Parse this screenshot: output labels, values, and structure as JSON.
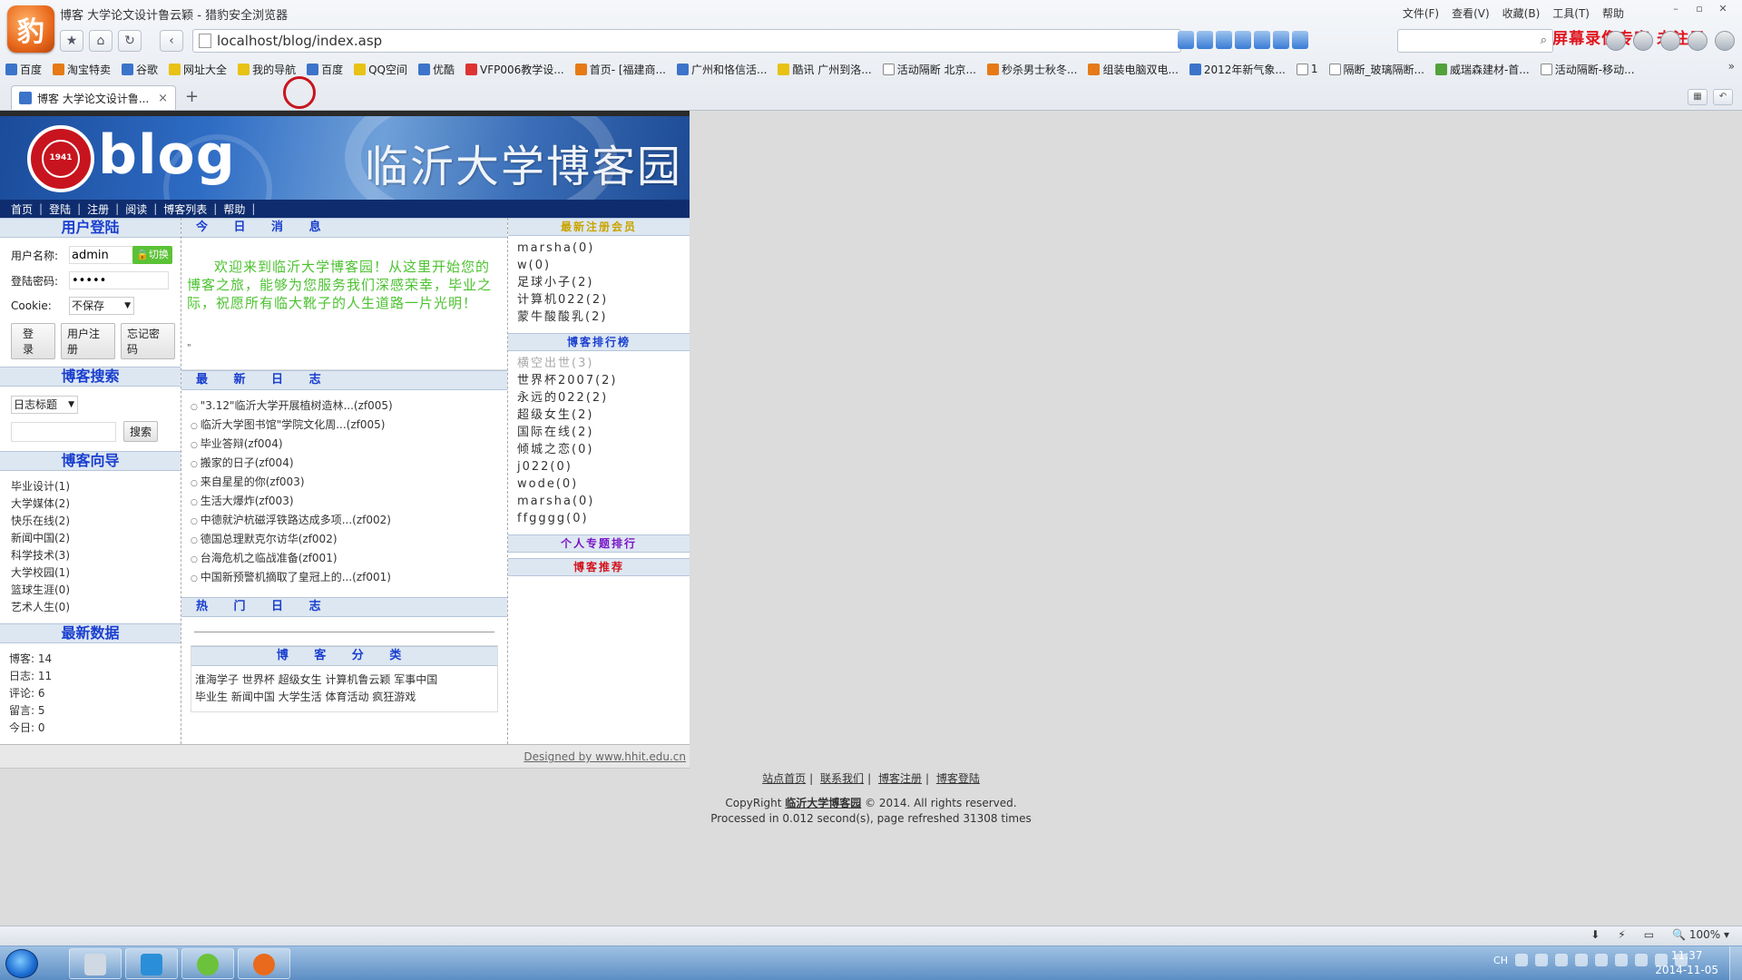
{
  "window": {
    "title": "博客 大学论文设计鲁云颖 - 猎豹安全浏览器",
    "menu": [
      "文件(F)",
      "查看(V)",
      "收藏(B)",
      "工具(T)",
      "帮助"
    ],
    "watermark": "屏幕录像专家 未注册"
  },
  "address": {
    "url": "localhost/blog/index.asp"
  },
  "bookmarks": [
    {
      "label": "百度",
      "color": "b"
    },
    {
      "label": "淘宝特卖",
      "color": "o"
    },
    {
      "label": "谷歌",
      "color": "b"
    },
    {
      "label": "网址大全",
      "color": "y"
    },
    {
      "label": "我的导航",
      "color": "y"
    },
    {
      "label": "百度",
      "color": "b"
    },
    {
      "label": "QQ空间",
      "color": "y"
    },
    {
      "label": "优酷",
      "color": "b"
    },
    {
      "label": "VFP006教学设...",
      "color": "r"
    },
    {
      "label": "首页- [福建商...",
      "color": "o"
    },
    {
      "label": "广州和恪信活...",
      "color": "b"
    },
    {
      "label": "酷讯 广州到洛...",
      "color": "y"
    },
    {
      "label": "活动隔断 北京...",
      "color": "p"
    },
    {
      "label": "秒杀男士秋冬...",
      "color": "o"
    },
    {
      "label": "组装电脑双电...",
      "color": "o"
    },
    {
      "label": "2012年新气象...",
      "color": "b"
    },
    {
      "label": "1",
      "color": "p"
    },
    {
      "label": "隔断_玻璃隔断...",
      "color": "p"
    },
    {
      "label": "威瑞森建材-首...",
      "color": "g"
    },
    {
      "label": "活动隔断-移动...",
      "color": "p"
    }
  ],
  "tab": {
    "label": "博客 大学论文设计鲁...",
    "close": "×",
    "new": "+"
  },
  "site": {
    "blog_word": "blog",
    "title": "临沂大学博客园",
    "seal_text": "临沂大学",
    "seal_year": "1941",
    "nav": [
      "首页",
      "登陆",
      "注册",
      "阅读",
      "博客列表",
      "帮助"
    ]
  },
  "login": {
    "heading": "用户登陆",
    "username_label": "用户名称:",
    "username_value": "admin",
    "switch_label": "切换",
    "password_label": "登陆密码:",
    "password_value": "•••••",
    "cookie_label": "Cookie:",
    "cookie_value": "不保存",
    "login_btn": "登录",
    "register_btn": "用户注册",
    "forgot_btn": "忘记密码"
  },
  "search": {
    "heading": "博客搜索",
    "type_value": "日志标题",
    "button": "搜索"
  },
  "guide": {
    "heading": "博客向导",
    "items": [
      "毕业设计(1)",
      "大学媒体(2)",
      "快乐在线(2)",
      "新闻中国(2)",
      "科学技术(3)",
      "大学校园(1)",
      "篮球生涯(0)",
      "艺术人生(0)"
    ]
  },
  "stats": {
    "heading": "最新数据",
    "items": [
      "博客: 14",
      "日志: 11",
      "评论: 6",
      "留言: 5",
      "今日: 0"
    ]
  },
  "today": {
    "heading": "今 日 消 息",
    "message": "欢迎来到临沂大学博客园！从这里开始您的博客之旅，能够为您服务我们深感荣幸，毕业之际，祝愿所有临大靴子的人生道路一片光明！",
    "foot": "\""
  },
  "latest": {
    "heading": "最 新 日 志",
    "items": [
      "\"3.12\"临沂大学开展植树造林...(zf005)",
      "临沂大学图书馆\"学院文化周...(zf005)",
      "毕业答辩(zf004)",
      "搬家的日子(zf004)",
      "来自星星的你(zf003)",
      "生活大爆炸(zf003)",
      "中德就沪杭磁浮铁路达成多项...(zf002)",
      "德国总理默克尔访华(zf002)",
      "台海危机之临战准备(zf001)",
      "中国新预警机摘取了皇冠上的...(zf001)"
    ]
  },
  "hot": {
    "heading": "热 门 日 志"
  },
  "categories": {
    "heading": "博 客 分 类",
    "line1": "淮海学子 世界杯 超级女生 计算机鲁云颖 军事中国",
    "line2": "毕业生 新闻中国 大学生活 体育活动 疯狂游戏"
  },
  "new_members": {
    "heading": "最新注册会员",
    "items": [
      "marsha(0)",
      "w(0)",
      "足球小子(2)",
      "计算机022(2)",
      "蒙牛酸酸乳(2)"
    ]
  },
  "ranking": {
    "heading": "博客排行榜",
    "items": [
      "横空出世(3)",
      "世界杯2007(2)",
      "永远的022(2)",
      "超级女生(2)",
      "国际在线(2)",
      "倾城之恋(0)",
      "j022(0)",
      "wode(0)",
      "marsha(0)",
      "ffgggg(0)"
    ]
  },
  "personal_rank": {
    "heading": "个人专题排行"
  },
  "recommend": {
    "heading": "博客推荐"
  },
  "site_foot": "Designed by www.hhit.edu.cn",
  "page_footer": {
    "links": [
      "站点首页",
      "联系我们",
      "博客注册",
      "博客登陆"
    ],
    "copy_prefix": "CopyRight ",
    "copy_brand": "临沂大学博客园",
    "copy_suffix": " © 2014. All rights reserved.",
    "processed": "Processed in 0.012 second(s), page refreshed 31308 times"
  },
  "status": {
    "zoom": "100%"
  },
  "taskbar": {
    "lang": "CH",
    "time": "11:37",
    "date": "2014-11-05"
  }
}
